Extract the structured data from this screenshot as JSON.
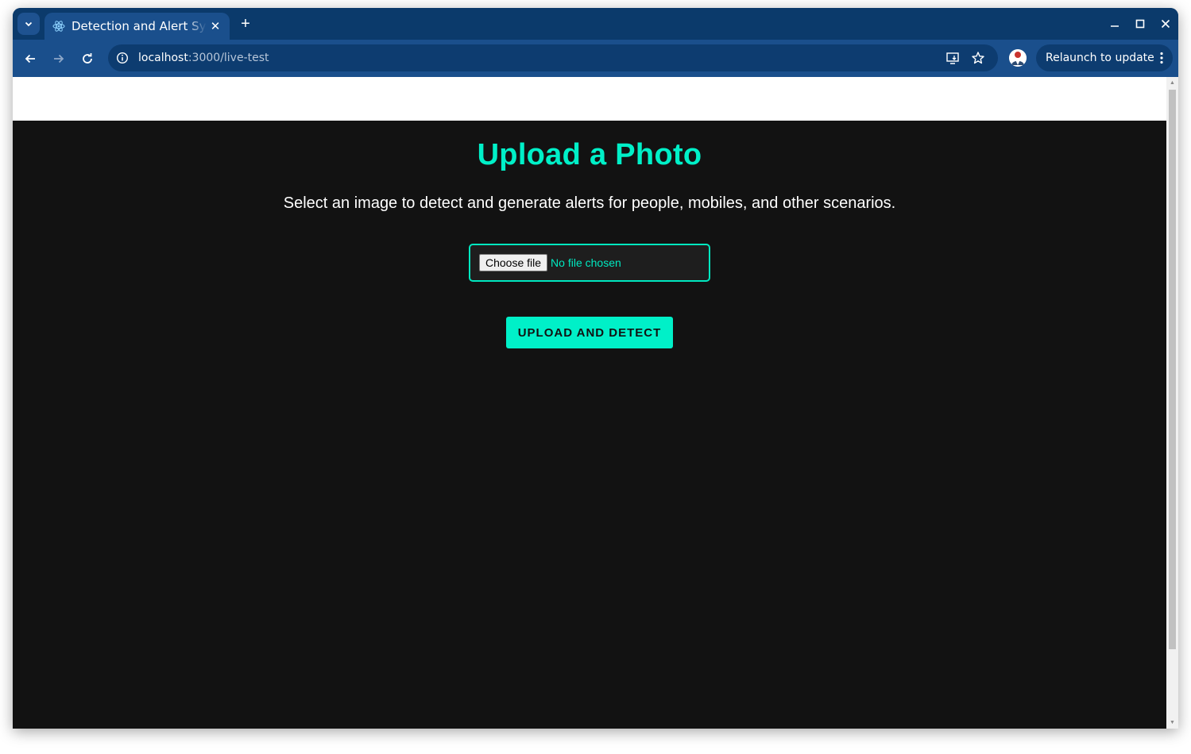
{
  "browser": {
    "tab": {
      "title": "Detection and Alert System",
      "favicon": "react-icon"
    },
    "address": {
      "host": "localhost",
      "path": ":3000/live-test"
    },
    "relaunch_label": "Relaunch to update"
  },
  "page": {
    "title": "Upload a Photo",
    "subtitle": "Select an image to detect and generate alerts for people, mobiles, and other scenarios.",
    "file_input": {
      "button_label": "Choose file",
      "status": "No file chosen"
    },
    "upload_button": "UPLOAD AND DETECT"
  },
  "colors": {
    "accent": "#00f0c8",
    "page_bg": "#121212",
    "chrome": "#0b3a6b",
    "toolbar": "#1a4f8c"
  }
}
